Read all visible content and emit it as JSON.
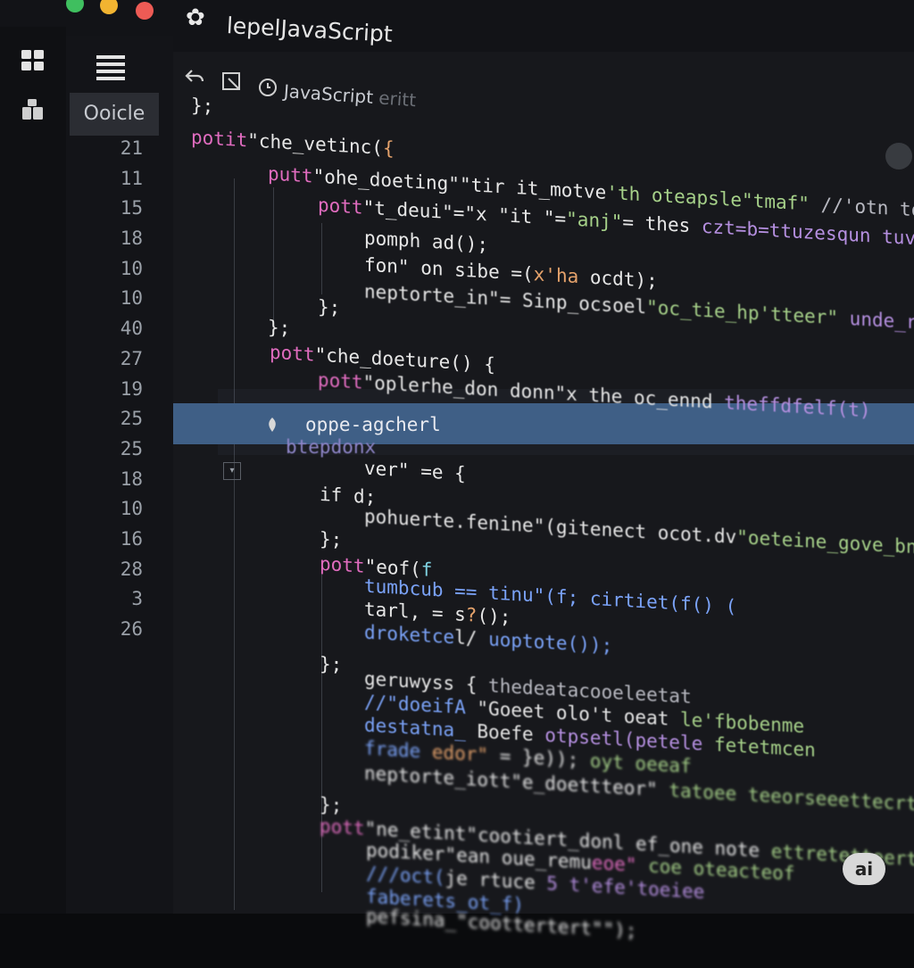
{
  "window": {
    "title": "lepelJavaScript",
    "traffic_lights": [
      "#3fbf5f",
      "#f2b431",
      "#ed5b55"
    ]
  },
  "sidebar": {
    "tab_label": "Ooicle",
    "line_numbers": [
      "21",
      "11",
      "15",
      "18",
      "10",
      "10",
      "40",
      "27",
      "19",
      "25",
      "25",
      "18",
      "10",
      "16",
      "28",
      "3",
      "26"
    ]
  },
  "editor": {
    "file_tab": "JavaScript",
    "file_tab_ghost": "eritt",
    "highlighted_line": "oppe-agcherl",
    "highlight_overlay": "btepdonx",
    "lines": [
      {
        "segments": [
          {
            "t": "};",
            "c": "punct"
          }
        ]
      },
      {
        "segments": [
          {
            "t": "potit",
            "c": "kw"
          },
          {
            "t": "\"che_vetinc(",
            "c": "fn"
          },
          {
            "t": "{",
            "c": "orange"
          }
        ]
      },
      {
        "segments": [
          {
            "t": "putt",
            "c": "kw"
          },
          {
            "t": "\"ohe_doeting\"",
            "c": "fn"
          },
          {
            "t": "\"tir it_motve",
            "c": "fn"
          },
          {
            "t": "'th oteapsle\"tmaf\"",
            "c": "str"
          },
          {
            "t": " //'otn tot",
            "c": "dim"
          }
        ]
      },
      {
        "segments": [
          {
            "t": "pott",
            "c": "kw"
          },
          {
            "t": "\"t_deui\"=\"x \"it \"=",
            "c": "fn"
          },
          {
            "t": "\"anj\"",
            "c": "str"
          },
          {
            "t": "= thes",
            "c": "fn"
          },
          {
            "t": " czt=b=ttuzesqun tuvt",
            "c": "purple"
          }
        ]
      },
      {
        "segments": [
          {
            "t": "pomph ad();",
            "c": "fn"
          }
        ]
      },
      {
        "segments": [
          {
            "t": "fon\" on sibe =(",
            "c": "fn"
          },
          {
            "t": "x'ha",
            "c": "orange"
          },
          {
            "t": " ocdt);",
            "c": "fn"
          }
        ]
      },
      {
        "segments": [
          {
            "t": "neptorte_in\"",
            "c": "fn"
          },
          {
            "t": "= Sinp_ocsoel",
            "c": "fn"
          },
          {
            "t": "\"oc_tie_hp'tteer\"",
            "c": "str"
          },
          {
            "t": " unde_r_oxtetee(ti)",
            "c": "purple"
          }
        ]
      },
      {
        "segments": [
          {
            "t": "};",
            "c": "punct"
          }
        ]
      },
      {
        "segments": [
          {
            "t": "};",
            "c": "punct"
          }
        ]
      },
      {
        "segments": [
          {
            "t": "pott",
            "c": "kw"
          },
          {
            "t": "\"che_doeture() {",
            "c": "fn"
          }
        ]
      },
      {
        "segments": [
          {
            "t": "pott",
            "c": "kw"
          },
          {
            "t": "\"oplerhe_don donn\"",
            "c": "fn"
          },
          {
            "t": "x the oc_ennd",
            "c": "fn"
          },
          {
            "t": " theffdfelf(t)",
            "c": "purple"
          }
        ]
      },
      {
        "segments": [
          {
            "t": "ver\" =e {",
            "c": "fn"
          }
        ]
      },
      {
        "segments": [
          {
            "t": "if",
            "c": "fn"
          },
          {
            "t": "   d;",
            "c": "fn"
          }
        ]
      },
      {
        "segments": [
          {
            "t": "pohuerte.fenine\"",
            "c": "fn"
          },
          {
            "t": "(gitenect ocot.dv",
            "c": "fn"
          },
          {
            "t": "\"oeteine_gove_bnvtae\"",
            "c": "str"
          }
        ]
      },
      {
        "segments": [
          {
            "t": "};",
            "c": "punct"
          }
        ]
      },
      {
        "segments": [
          {
            "t": "pott",
            "c": "kw"
          },
          {
            "t": "\"eof(",
            "c": "fn"
          },
          {
            "t": "f",
            "c": "cyan"
          }
        ]
      },
      {
        "segments": [
          {
            "t": "tumbcub == tinu\"(f; cirtiet(f() (",
            "c": "blue"
          }
        ]
      },
      {
        "segments": [
          {
            "t": "tarl, = s",
            "c": "fn"
          },
          {
            "t": "?",
            "c": "orange"
          },
          {
            "t": "();",
            "c": "fn"
          }
        ]
      },
      {
        "segments": [
          {
            "t": "droketce",
            "c": "blue"
          },
          {
            "t": "l/ ",
            "c": "fn"
          },
          {
            "t": "uoptote());",
            "c": "blue"
          }
        ]
      },
      {
        "segments": [
          {
            "t": "};",
            "c": "punct"
          }
        ]
      },
      {
        "segments": [
          {
            "t": "geruwyss {",
            "c": "fn"
          },
          {
            "t": "  thedeatacooeleetat",
            "c": "dim"
          }
        ]
      },
      {
        "segments": [
          {
            "t": "//\"doeifA ",
            "c": "blue"
          },
          {
            "t": "\"Goeet olo't oeat",
            "c": "fn"
          },
          {
            "t": " le'fbobenme",
            "c": "str"
          }
        ]
      },
      {
        "segments": [
          {
            "t": "destatna_",
            "c": "blue"
          },
          {
            "t": " Boefe ",
            "c": "fn"
          },
          {
            "t": "otpsetl(petele",
            "c": "purple"
          },
          {
            "t": " fetetmcen",
            "c": "str"
          }
        ]
      },
      {
        "segments": [
          {
            "t": "frade ",
            "c": "blue"
          },
          {
            "t": "edor\"",
            "c": "orange"
          },
          {
            "t": " = ",
            "c": "fn"
          },
          {
            "t": "}e));",
            "c": "fn"
          },
          {
            "t": "  oyt oeeaf",
            "c": "str"
          }
        ]
      },
      {
        "segments": [
          {
            "t": "neptorte_iott",
            "c": "fn"
          },
          {
            "t": "\"e_doettteor\"",
            "c": "fn"
          },
          {
            "t": " tatoee teeorseeettecrte",
            "c": "str"
          }
        ]
      },
      {
        "segments": [
          {
            "t": "};",
            "c": "punct"
          }
        ]
      },
      {
        "segments": [
          {
            "t": "pott",
            "c": "kw"
          },
          {
            "t": "\"ne_etint\"cootiert_donl ef_one note",
            "c": "fn"
          },
          {
            "t": " ettretetteertcene",
            "c": "str"
          }
        ]
      },
      {
        "segments": [
          {
            "t": "podiker\"ean ",
            "c": "fn"
          },
          {
            "t": "oue_remu",
            "c": "fn"
          },
          {
            "t": "eoe\" ",
            "c": "kw"
          },
          {
            "t": "coe oteacteof",
            "c": "str"
          }
        ]
      },
      {
        "segments": [
          {
            "t": "///oct(",
            "c": "blue"
          },
          {
            "t": "je ",
            "c": "fn"
          },
          {
            "t": "rtuce",
            "c": "fn"
          },
          {
            "t": "  5 t'efe'toeiee",
            "c": "purple"
          }
        ]
      },
      {
        "segments": [
          {
            "t": "faberets_ot_f)",
            "c": "blue"
          }
        ]
      },
      {
        "segments": [
          {
            "t": "pefsina_",
            "c": "fn"
          },
          {
            "t": "\"coottertert\"",
            "c": "fn"
          },
          {
            "t": "\");",
            "c": "fn"
          }
        ]
      }
    ]
  },
  "badge": {
    "label": "ai"
  }
}
